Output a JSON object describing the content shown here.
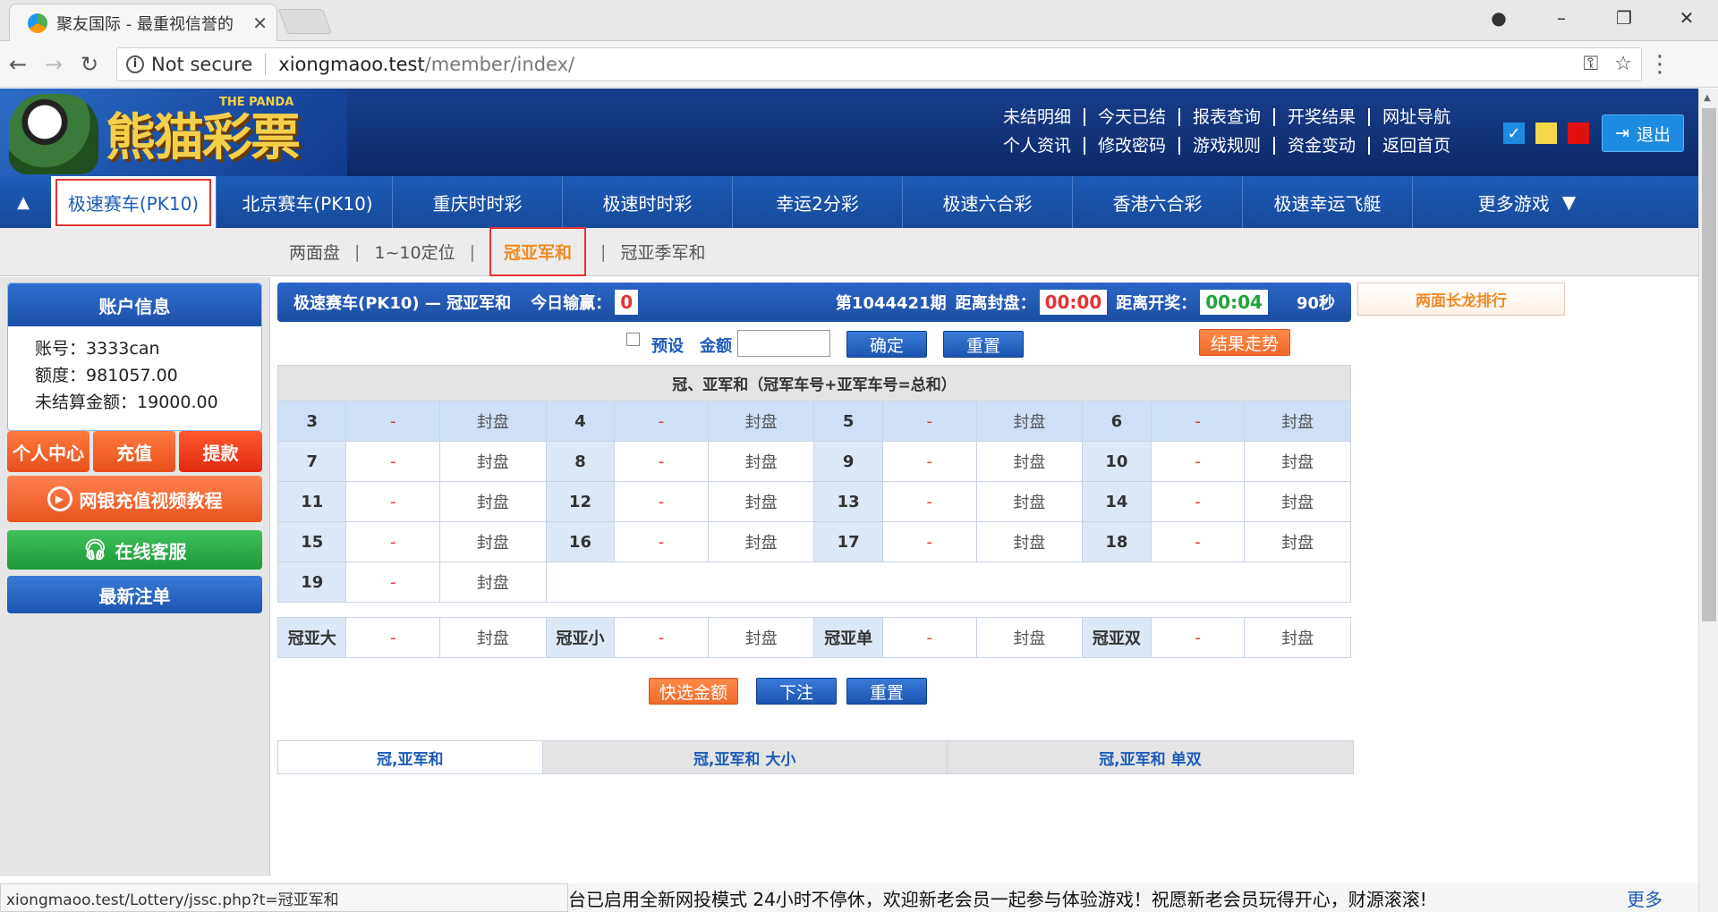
{
  "browser": {
    "tab_title": "聚友国际 - 最重视信誉的",
    "not_secure": "Not secure",
    "url_host": "xiongmaoo.test",
    "url_path": "/member/index/",
    "status_url": "xiongmaoo.test/Lottery/jssc.php?t=冠亚军和"
  },
  "header": {
    "brand": "熊猫彩票",
    "brand_sub": "THE PANDA",
    "links_row1": [
      "未结明细",
      "今天已结",
      "报表查询",
      "开奖结果",
      "网址导航"
    ],
    "links_row2": [
      "个人资讯",
      "修改密码",
      "游戏规则",
      "资金变动",
      "返回首页"
    ],
    "logout": "退出",
    "theme_colors": [
      "#1e8be0",
      "#f4d84a",
      "#e01010"
    ]
  },
  "gamenav": {
    "items": [
      "极速赛车(PK10)",
      "北京赛车(PK10)",
      "重庆时时彩",
      "极速时时彩",
      "幸运2分彩",
      "极速六合彩",
      "香港六合彩",
      "极速幸运飞艇"
    ],
    "more": "更多游戏"
  },
  "subnav": {
    "items": [
      "两面盘",
      "1~10定位",
      "冠亚军和",
      "冠亚季军和"
    ]
  },
  "sidebar": {
    "title": "账户信息",
    "account_label": "账号：",
    "account": "3333can",
    "quota_label": "额度：",
    "quota": "981057.00",
    "unsettled_label": "未结算金额：",
    "unsettled": "19000.00",
    "btn_center": "个人中心",
    "btn_deposit": "充值",
    "btn_withdraw": "提款",
    "btn_tutorial": "网银充值视频教程",
    "btn_service": "在线客服",
    "btn_latest": "最新注单"
  },
  "infobar": {
    "game": "极速赛车(PK10) — 冠亚军和",
    "today_label": "今日输赢：",
    "today_value": "0",
    "period": "第1044421期",
    "close_label": "距离封盘：",
    "close_time": "00:00",
    "draw_label": "距离开奖：",
    "draw_time": "00:04",
    "seconds": "90秒"
  },
  "controls": {
    "preset": "预设",
    "amount": "金额",
    "confirm": "确定",
    "reset": "重置",
    "trend": "结果走势",
    "quick": "快选金额",
    "bet": "下注",
    "reset2": "重置"
  },
  "table": {
    "title": "冠、亚军和（冠军车号+亚军车号=总和）",
    "odds": "-",
    "status": "封盘",
    "rows": [
      [
        "3",
        "4",
        "5",
        "6"
      ],
      [
        "7",
        "8",
        "9",
        "10"
      ],
      [
        "11",
        "12",
        "13",
        "14"
      ],
      [
        "15",
        "16",
        "17",
        "18"
      ],
      [
        "19"
      ]
    ],
    "extras": [
      "冠亚大",
      "冠亚小",
      "冠亚单",
      "冠亚双"
    ]
  },
  "bottom_tabs": [
    "冠,亚军和",
    "冠,亚军和 大小",
    "冠,亚军和 单双"
  ],
  "rank_box": "两面长龙排行",
  "marquee": {
    "text": "台已启用全新网投模式 24小时不停休，欢迎新老会员一起参与体验游戏！祝愿新老会员玩得开心，财源滚滚!",
    "more": "更多"
  }
}
